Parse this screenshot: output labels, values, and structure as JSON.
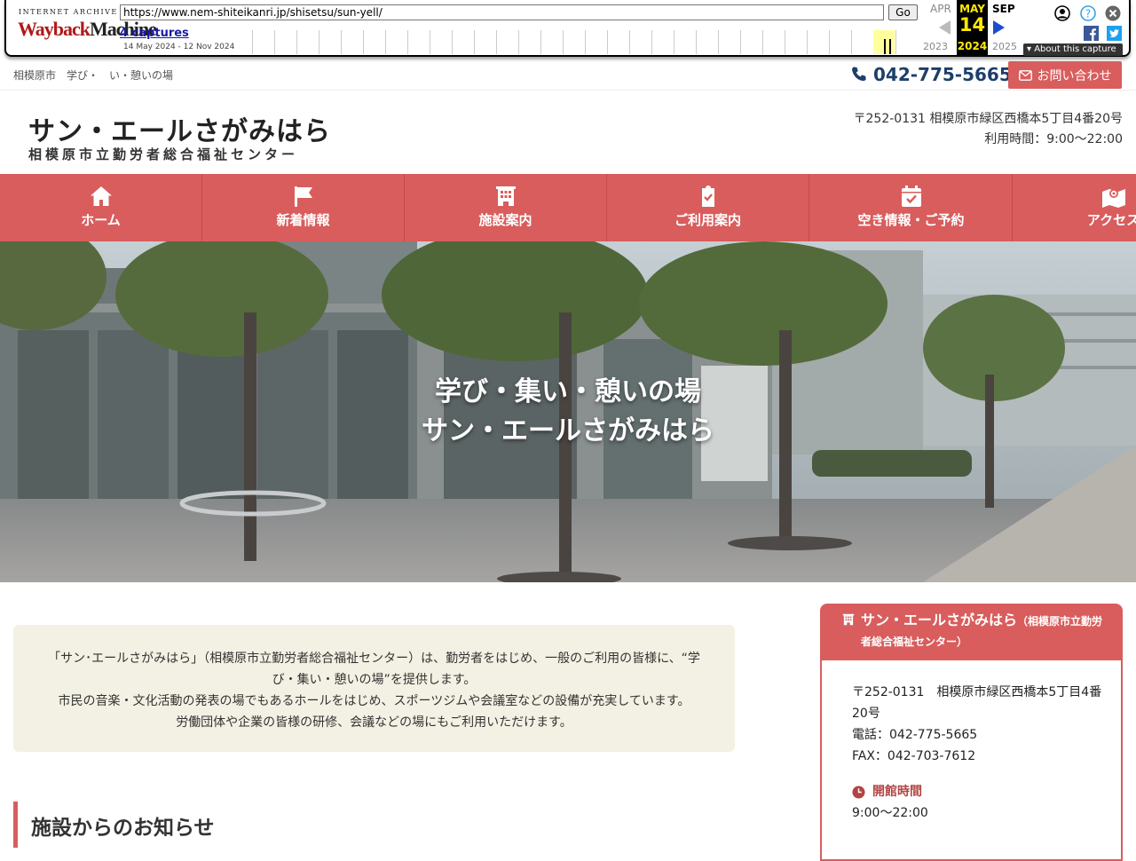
{
  "wayback": {
    "logo_top": "INTERNET ARCHIVE",
    "logo_main_a": "Wayback",
    "logo_main_b": "Machine",
    "url": "https://www.nem-shiteikanri.jp/shisetsu/sun-yell/",
    "go_label": "Go",
    "captures": "4 captures",
    "range": "14 May 2024 - 12 Nov 2024",
    "prev_month": "APR",
    "cur_month": "MAY",
    "next_month": "SEP",
    "cur_day": "14",
    "prev_year": "2023",
    "cur_year": "2024",
    "next_year": "2025",
    "about": "About this capture"
  },
  "topbar": {
    "tagline": "相模原市　学び・ い・憩いの場",
    "phone": "042-775-5665",
    "contact_label": "お問い合わせ"
  },
  "header": {
    "title": "サン・エールさがみはら",
    "subtitle": "相模原市立勤労者総合福祉センター",
    "address": "〒252-0131 相模原市緑区西橋本5丁目4番20号",
    "hours": "利用時間：9:00〜22:00"
  },
  "nav": [
    {
      "label": "ホーム",
      "icon": "home-icon"
    },
    {
      "label": "新着情報",
      "icon": "flag-icon"
    },
    {
      "label": "施設案内",
      "icon": "building-icon"
    },
    {
      "label": "ご利用案内",
      "icon": "clipboard-check-icon"
    },
    {
      "label": "空き情報・ご予約",
      "icon": "calendar-check-icon"
    },
    {
      "label": "アクセス",
      "icon": "map-icon"
    }
  ],
  "hero": {
    "line1": "学び・集い・憩いの場",
    "line2": "サン・エールさがみはら"
  },
  "intro": {
    "p1": "「サン･エールさがみはら」（相模原市立勤労者総合福祉センター）は、勤労者をはじめ、一般のご利用の皆様に、“学び・集い・憩いの場”を提供します。",
    "p2": "市民の音楽・文化活動の発表の場でもあるホールをはじめ、スポーツジムや会議室などの設備が充実しています。",
    "p3": "労働団体や企業の皆様の研修、会議などの場にもご利用いただけます。"
  },
  "notice": {
    "heading": "施設からのお知らせ"
  },
  "side": {
    "name": "サン・エールさがみはら",
    "sub": "（相模原市立勤労者総合福祉センター）",
    "address": "〒252-0131　相模原市緑区西橋本5丁目4番20号",
    "tel": "電話：042-775-5665",
    "fax": "FAX：042-703-7612",
    "hours_heading": "開館時間",
    "hours": "9:00〜22:00"
  },
  "colors": {
    "accent": "#d95d5d",
    "navy": "#1d3f6b",
    "intro_bg": "#f3f1e3"
  }
}
